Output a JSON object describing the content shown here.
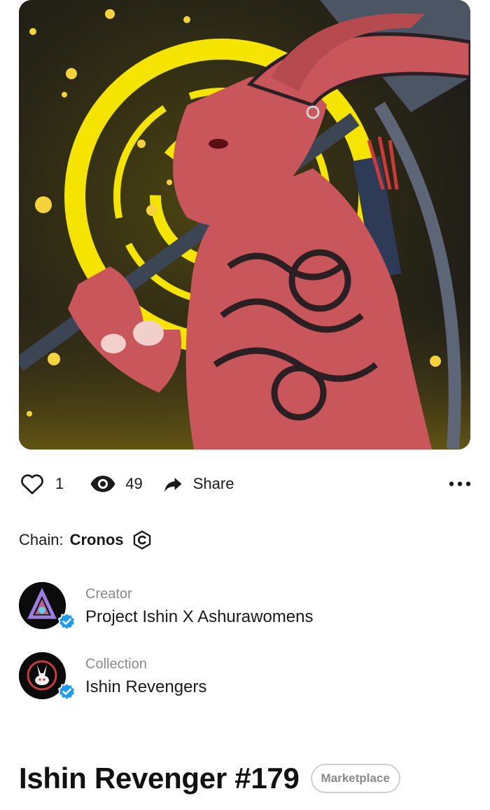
{
  "nft": {
    "title": "Ishin Revenger #179",
    "badge": "Marketplace"
  },
  "stats": {
    "likes": "1",
    "views": "49",
    "share_label": "Share"
  },
  "chain": {
    "label": "Chain:",
    "value": "Cronos"
  },
  "creator": {
    "label": "Creator",
    "name": "Project Ishin X Ashurawomens"
  },
  "collection": {
    "label": "Collection",
    "name": "Ishin Revengers"
  },
  "colors": {
    "verified": "#1d9bf0",
    "artwork_bg": "#1e1d1b",
    "halo": "#f5e400",
    "rabbit": "#c9565a"
  },
  "icons": [
    "heart-icon",
    "eye-icon",
    "share-arrow-icon",
    "more-dots-icon",
    "cronos-icon",
    "verified-icon"
  ]
}
